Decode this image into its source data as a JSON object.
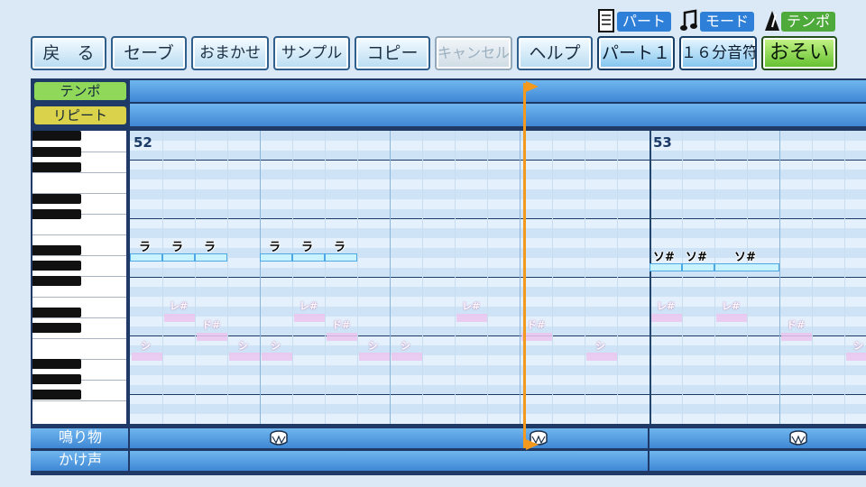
{
  "toolbar": {
    "back": "戻　る",
    "save": "セーブ",
    "auto": "おまかせ",
    "sample": "サンプル",
    "copy": "コピー",
    "cancel": "キャンセル",
    "help": "ヘルプ"
  },
  "modes": {
    "part_label": "パート",
    "mode_label": "モード",
    "tempo_label": "テンポ",
    "part_value": "パート１",
    "mode_value": "１６分音符",
    "tempo_value": "おそい"
  },
  "rows": {
    "tempo": "テンポ",
    "repeat": "リピート",
    "percussion": "鳴り物",
    "chant": "かけ声"
  },
  "measures": [
    "52",
    "53"
  ],
  "notes": [
    {
      "label": "ラ"
    },
    {
      "label": "ラ"
    },
    {
      "label": "ラ"
    },
    {
      "label": "ラ"
    },
    {
      "label": "ラ"
    },
    {
      "label": "ラ"
    },
    {
      "label": "ソ#"
    },
    {
      "label": "ソ#"
    },
    {
      "label": "ソ#"
    }
  ],
  "ghost_notes": [
    {
      "label": "シ"
    },
    {
      "label": "レ#"
    },
    {
      "label": "ド#"
    },
    {
      "label": "シ"
    },
    {
      "label": "シ"
    },
    {
      "label": "レ#"
    },
    {
      "label": "ド#"
    },
    {
      "label": "シ"
    },
    {
      "label": "シ"
    },
    {
      "label": "レ#"
    },
    {
      "label": "ド#"
    },
    {
      "label": "シ"
    },
    {
      "label": "レ#"
    },
    {
      "label": "レ#"
    },
    {
      "label": "ド#"
    },
    {
      "label": "シ"
    }
  ],
  "colors": {
    "part_badge": "#2e7fd8",
    "mode_badge": "#2e7fd8",
    "tempo_badge": "#4faa3c",
    "tempo_row": "#8fd85a",
    "repeat_row": "#d9d24a",
    "cursor": "#f39a1e"
  }
}
